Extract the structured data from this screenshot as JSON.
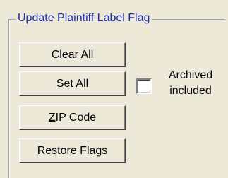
{
  "group": {
    "title": "Update Plaintiff Label Flag"
  },
  "buttons": {
    "clear_all": {
      "mnemonic": "C",
      "rest": "lear All"
    },
    "set_all": {
      "mnemonic": "S",
      "rest": "et All"
    },
    "zip_code": {
      "mnemonic": "Z",
      "rest": "IP Code"
    },
    "restore_flags": {
      "mnemonic": "R",
      "rest": "estore Flags"
    }
  },
  "archived": {
    "checked": false,
    "label_line1": "Archived",
    "label_line2": "included"
  }
}
